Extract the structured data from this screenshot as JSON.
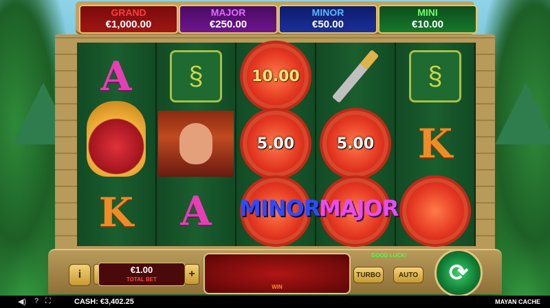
{
  "jackpots": {
    "grand": {
      "label": "GRAND",
      "value": "€1,000.00"
    },
    "major": {
      "label": "MAJOR",
      "value": "€250.00"
    },
    "minor": {
      "label": "MINOR",
      "value": "€50.00"
    },
    "mini": {
      "label": "MINI",
      "value": "€10.00"
    }
  },
  "reels": {
    "col1": {
      "top": "A",
      "bottom": "K"
    },
    "col2": {
      "bottom": "A"
    },
    "col3": {
      "top": "10.00",
      "mid": "5.00",
      "bottom": "MINOR"
    },
    "col4": {
      "mid": "5.00",
      "bottom": "MAJOR"
    },
    "col5": {
      "mid": "K"
    }
  },
  "controls": {
    "info_label": "i",
    "minus_label": "−",
    "plus_label": "+",
    "bet_value": "€1.00",
    "bet_label": "TOTAL BET",
    "win_label": "WIN",
    "good_luck": "GOOD LUCK!",
    "turbo_label": "TURBO",
    "auto_label": "AUTO",
    "spin_glyph": "⟳"
  },
  "status": {
    "cash": "CASH:  €3,402.25",
    "game_title": "MAYAN CACHE",
    "sound_glyph": "◀)",
    "help_glyph": "?",
    "fullscreen_glyph": "⛶"
  }
}
